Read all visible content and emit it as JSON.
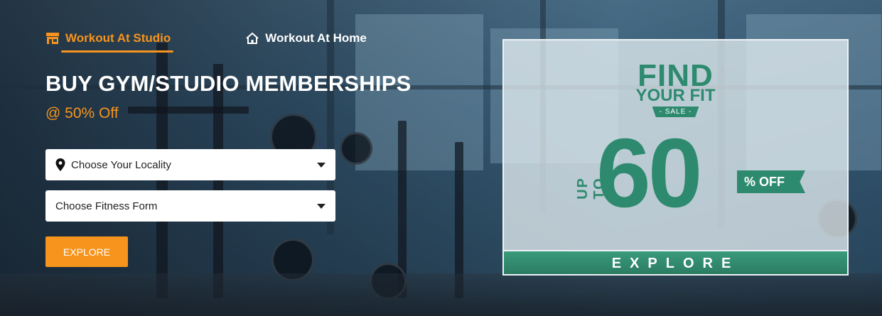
{
  "tabs": {
    "studio": "Workout At Studio",
    "home": "Workout At Home"
  },
  "hero": {
    "headline": "BUY GYM/STUDIO MEMBERSHIPS",
    "subhead": "@ 50% Off"
  },
  "form": {
    "locality_placeholder": "Choose Your Locality",
    "fitness_placeholder": "Choose Fitness Form",
    "explore_label": "EXPLORE"
  },
  "promo": {
    "find": "FIND",
    "your_fit": "YOUR FIT",
    "sale": "- SALE -",
    "up_to": "UP TO",
    "amount": "60",
    "off": "% OFF",
    "explore": "EXPLORE"
  },
  "colors": {
    "accent": "#f7941d",
    "promo_green": "#2e8a6e"
  },
  "icons": [
    "store-icon",
    "home-icon",
    "location-pin-icon",
    "caret-down-icon"
  ]
}
